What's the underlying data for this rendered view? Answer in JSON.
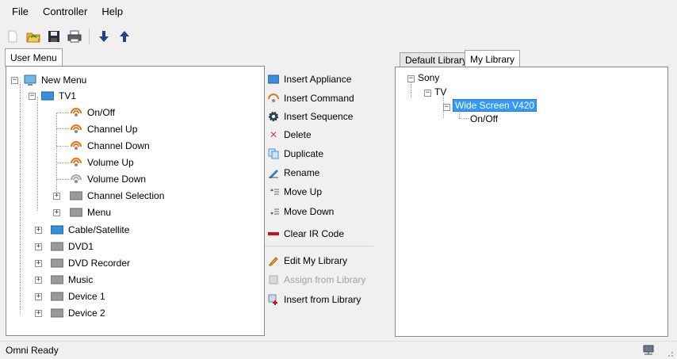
{
  "menubar": {
    "file": "File",
    "controller": "Controller",
    "help": "Help"
  },
  "toolbar": {
    "icons": [
      "new-icon",
      "open-icon",
      "save-icon",
      "print-icon",
      "download-icon",
      "upload-icon"
    ]
  },
  "tabs": {
    "user_menu": "User Menu",
    "default_library": "Default Library",
    "my_library": "My Library"
  },
  "user_menu_tree": {
    "root": "New Menu",
    "tv1": "TV1",
    "tv1_items": [
      "On/Off",
      "Channel Up",
      "Channel Down",
      "Volume Up",
      "Volume Down"
    ],
    "tv1_groups": [
      "Channel Selection",
      "Menu"
    ],
    "devices": [
      "Cable/Satellite",
      "DVD1",
      "DVD Recorder",
      "Music",
      "Device 1",
      "Device 2"
    ]
  },
  "actions": {
    "insert_appliance": "Insert Appliance",
    "insert_command": "Insert Command",
    "insert_sequence": "Insert Sequence",
    "delete": "Delete",
    "duplicate": "Duplicate",
    "rename": "Rename",
    "move_up": "Move Up",
    "move_down": "Move Down",
    "clear_ir_code": "Clear IR Code",
    "edit_my_library": "Edit My Library",
    "assign_from_library": "Assign from Library",
    "insert_from_library": "Insert from Library"
  },
  "library_tree": {
    "brand": "Sony",
    "category": "TV",
    "model": "Wide Screen V420",
    "command": "On/Off"
  },
  "status": {
    "text": "Omni Ready"
  },
  "colors": {
    "selection": "#3399ff",
    "command_orange": "#e07b1a",
    "device_blue": "#3b8fd6",
    "clear_red": "#d01010"
  }
}
